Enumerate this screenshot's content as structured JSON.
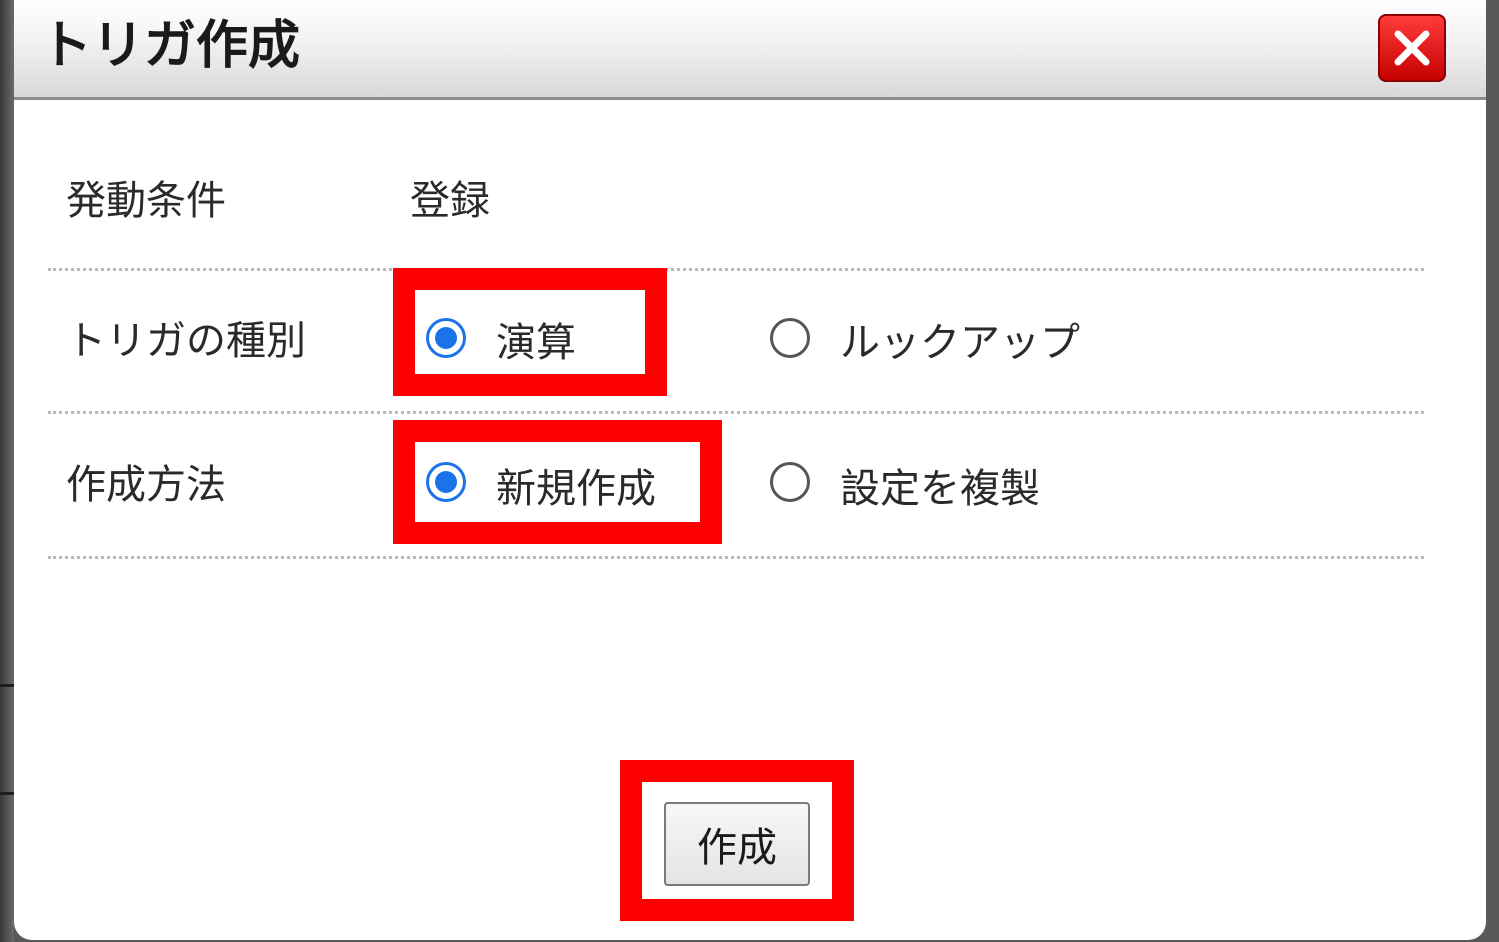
{
  "dialog": {
    "title": "トリガ作成",
    "close_icon": "close-icon"
  },
  "rows": {
    "condition": {
      "label": "発動条件",
      "value": "登録"
    },
    "trigger_type": {
      "label": "トリガの種別",
      "options": [
        {
          "label": "演算",
          "selected": true
        },
        {
          "label": "ルックアップ",
          "selected": false
        }
      ]
    },
    "method": {
      "label": "作成方法",
      "options": [
        {
          "label": "新規作成",
          "selected": true
        },
        {
          "label": "設定を複製",
          "selected": false
        }
      ]
    }
  },
  "actions": {
    "create_label": "作成"
  },
  "colors": {
    "highlight": "#ff0000",
    "radio_accent": "#1a73e8",
    "close_button": "#d40000"
  }
}
